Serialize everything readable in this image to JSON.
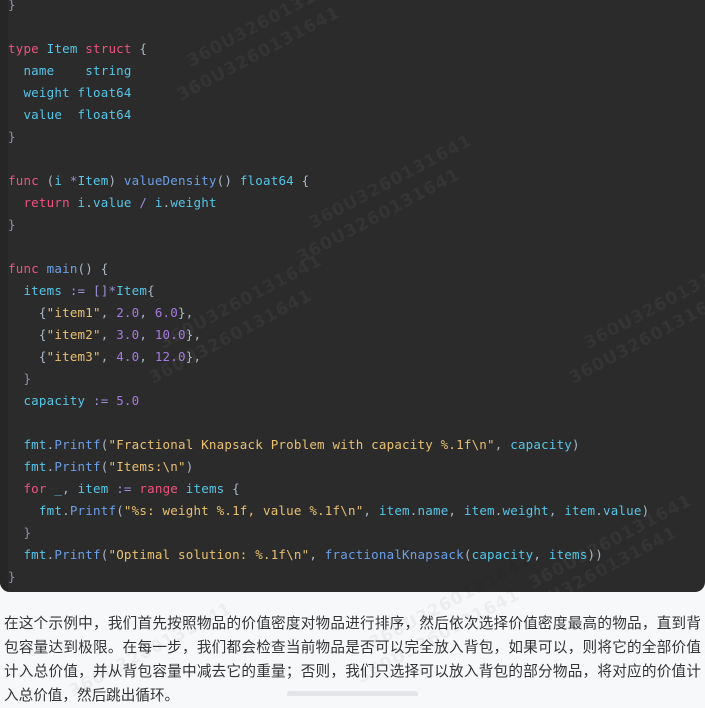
{
  "watermark": {
    "text": "360U3260131641",
    "repeats": 8
  },
  "code_block": {
    "language": "go",
    "background": "#2b2b2b",
    "colors": {
      "keyword": "#f0527f",
      "identifier": "#54c6e8",
      "function": "#6b9fe8",
      "string": "#e8c070",
      "number": "#a679e0",
      "operator": "#9a8fd8",
      "punctuation": "#a9b7c6"
    },
    "lines": [
      {
        "indent": 0,
        "tokens": [
          {
            "t": "}",
            "c": "brc"
          }
        ]
      },
      {
        "indent": 0,
        "tokens": []
      },
      {
        "indent": 0,
        "tokens": [
          {
            "t": "type",
            "c": "kw"
          },
          {
            "t": " ",
            "c": "pun"
          },
          {
            "t": "Item",
            "c": "id"
          },
          {
            "t": " ",
            "c": "pun"
          },
          {
            "t": "struct",
            "c": "kw"
          },
          {
            "t": " ",
            "c": "pun"
          },
          {
            "t": "{",
            "c": "pun"
          }
        ]
      },
      {
        "indent": 1,
        "tokens": [
          {
            "t": "name",
            "c": "id"
          },
          {
            "t": "    ",
            "c": "pun"
          },
          {
            "t": "string",
            "c": "id"
          }
        ]
      },
      {
        "indent": 1,
        "tokens": [
          {
            "t": "weight",
            "c": "id"
          },
          {
            "t": " ",
            "c": "pun"
          },
          {
            "t": "float64",
            "c": "id"
          }
        ]
      },
      {
        "indent": 1,
        "tokens": [
          {
            "t": "value",
            "c": "id"
          },
          {
            "t": "  ",
            "c": "pun"
          },
          {
            "t": "float64",
            "c": "id"
          }
        ]
      },
      {
        "indent": 0,
        "tokens": [
          {
            "t": "}",
            "c": "brc"
          }
        ]
      },
      {
        "indent": 0,
        "tokens": []
      },
      {
        "indent": 0,
        "tokens": [
          {
            "t": "func",
            "c": "kw"
          },
          {
            "t": " (",
            "c": "pun"
          },
          {
            "t": "i",
            "c": "id"
          },
          {
            "t": " ",
            "c": "pun"
          },
          {
            "t": "*",
            "c": "op"
          },
          {
            "t": "Item",
            "c": "id"
          },
          {
            "t": ") ",
            "c": "pun"
          },
          {
            "t": "valueDensity",
            "c": "fn"
          },
          {
            "t": "() ",
            "c": "pun"
          },
          {
            "t": "float64",
            "c": "id"
          },
          {
            "t": " {",
            "c": "pun"
          }
        ]
      },
      {
        "indent": 1,
        "tokens": [
          {
            "t": "return",
            "c": "kw"
          },
          {
            "t": " ",
            "c": "pun"
          },
          {
            "t": "i",
            "c": "id"
          },
          {
            "t": ".",
            "c": "pun"
          },
          {
            "t": "value",
            "c": "id"
          },
          {
            "t": " ",
            "c": "pun"
          },
          {
            "t": "/",
            "c": "op"
          },
          {
            "t": " ",
            "c": "pun"
          },
          {
            "t": "i",
            "c": "id"
          },
          {
            "t": ".",
            "c": "pun"
          },
          {
            "t": "weight",
            "c": "id"
          }
        ]
      },
      {
        "indent": 0,
        "tokens": [
          {
            "t": "}",
            "c": "brc"
          }
        ]
      },
      {
        "indent": 0,
        "tokens": []
      },
      {
        "indent": 0,
        "tokens": [
          {
            "t": "func",
            "c": "kw"
          },
          {
            "t": " ",
            "c": "pun"
          },
          {
            "t": "main",
            "c": "fn"
          },
          {
            "t": "() {",
            "c": "pun"
          }
        ]
      },
      {
        "indent": 1,
        "tokens": [
          {
            "t": "items",
            "c": "id"
          },
          {
            "t": " ",
            "c": "pun"
          },
          {
            "t": ":=",
            "c": "op"
          },
          {
            "t": " ",
            "c": "pun"
          },
          {
            "t": "[]",
            "c": "op"
          },
          {
            "t": "*",
            "c": "op"
          },
          {
            "t": "Item",
            "c": "id"
          },
          {
            "t": "{",
            "c": "pun"
          }
        ]
      },
      {
        "indent": 2,
        "tokens": [
          {
            "t": "{",
            "c": "pun"
          },
          {
            "t": "\"item1\"",
            "c": "str"
          },
          {
            "t": ", ",
            "c": "pun"
          },
          {
            "t": "2.0",
            "c": "num"
          },
          {
            "t": ", ",
            "c": "pun"
          },
          {
            "t": "6.0",
            "c": "num"
          },
          {
            "t": "},",
            "c": "pun"
          }
        ]
      },
      {
        "indent": 2,
        "tokens": [
          {
            "t": "{",
            "c": "pun"
          },
          {
            "t": "\"item2\"",
            "c": "str"
          },
          {
            "t": ", ",
            "c": "pun"
          },
          {
            "t": "3.0",
            "c": "num"
          },
          {
            "t": ", ",
            "c": "pun"
          },
          {
            "t": "10.0",
            "c": "num"
          },
          {
            "t": "},",
            "c": "pun"
          }
        ]
      },
      {
        "indent": 2,
        "tokens": [
          {
            "t": "{",
            "c": "pun"
          },
          {
            "t": "\"item3\"",
            "c": "str"
          },
          {
            "t": ", ",
            "c": "pun"
          },
          {
            "t": "4.0",
            "c": "num"
          },
          {
            "t": ", ",
            "c": "pun"
          },
          {
            "t": "12.0",
            "c": "num"
          },
          {
            "t": "},",
            "c": "pun"
          }
        ]
      },
      {
        "indent": 1,
        "tokens": [
          {
            "t": "}",
            "c": "brc"
          }
        ]
      },
      {
        "indent": 1,
        "tokens": [
          {
            "t": "capacity",
            "c": "id"
          },
          {
            "t": " ",
            "c": "pun"
          },
          {
            "t": ":=",
            "c": "op"
          },
          {
            "t": " ",
            "c": "pun"
          },
          {
            "t": "5.0",
            "c": "num"
          }
        ]
      },
      {
        "indent": 0,
        "tokens": []
      },
      {
        "indent": 1,
        "tokens": [
          {
            "t": "fmt",
            "c": "id"
          },
          {
            "t": ".",
            "c": "pun"
          },
          {
            "t": "Printf",
            "c": "fn"
          },
          {
            "t": "(",
            "c": "pun"
          },
          {
            "t": "\"Fractional Knapsack Problem with capacity %.1f\\n\"",
            "c": "str"
          },
          {
            "t": ", ",
            "c": "pun"
          },
          {
            "t": "capacity",
            "c": "id"
          },
          {
            "t": ")",
            "c": "pun"
          }
        ]
      },
      {
        "indent": 1,
        "tokens": [
          {
            "t": "fmt",
            "c": "id"
          },
          {
            "t": ".",
            "c": "pun"
          },
          {
            "t": "Printf",
            "c": "fn"
          },
          {
            "t": "(",
            "c": "pun"
          },
          {
            "t": "\"Items:\\n\"",
            "c": "str"
          },
          {
            "t": ")",
            "c": "pun"
          }
        ]
      },
      {
        "indent": 1,
        "tokens": [
          {
            "t": "for",
            "c": "kw"
          },
          {
            "t": " ",
            "c": "pun"
          },
          {
            "t": "_",
            "c": "id"
          },
          {
            "t": ", ",
            "c": "pun"
          },
          {
            "t": "item",
            "c": "id"
          },
          {
            "t": " ",
            "c": "pun"
          },
          {
            "t": ":=",
            "c": "op"
          },
          {
            "t": " ",
            "c": "pun"
          },
          {
            "t": "range",
            "c": "kw"
          },
          {
            "t": " ",
            "c": "pun"
          },
          {
            "t": "items",
            "c": "id"
          },
          {
            "t": " {",
            "c": "pun"
          }
        ]
      },
      {
        "indent": 2,
        "tokens": [
          {
            "t": "fmt",
            "c": "id"
          },
          {
            "t": ".",
            "c": "pun"
          },
          {
            "t": "Printf",
            "c": "fn"
          },
          {
            "t": "(",
            "c": "pun"
          },
          {
            "t": "\"%s: weight %.1f, value %.1f\\n\"",
            "c": "str"
          },
          {
            "t": ", ",
            "c": "pun"
          },
          {
            "t": "item",
            "c": "id"
          },
          {
            "t": ".",
            "c": "pun"
          },
          {
            "t": "name",
            "c": "id"
          },
          {
            "t": ", ",
            "c": "pun"
          },
          {
            "t": "item",
            "c": "id"
          },
          {
            "t": ".",
            "c": "pun"
          },
          {
            "t": "weight",
            "c": "id"
          },
          {
            "t": ", ",
            "c": "pun"
          },
          {
            "t": "item",
            "c": "id"
          },
          {
            "t": ".",
            "c": "pun"
          },
          {
            "t": "value",
            "c": "id"
          },
          {
            "t": ")",
            "c": "pun"
          }
        ]
      },
      {
        "indent": 1,
        "tokens": [
          {
            "t": "}",
            "c": "brc"
          }
        ]
      },
      {
        "indent": 1,
        "tokens": [
          {
            "t": "fmt",
            "c": "id"
          },
          {
            "t": ".",
            "c": "pun"
          },
          {
            "t": "Printf",
            "c": "fn"
          },
          {
            "t": "(",
            "c": "pun"
          },
          {
            "t": "\"Optimal solution: %.1f\\n\"",
            "c": "str"
          },
          {
            "t": ", ",
            "c": "pun"
          },
          {
            "t": "fractionalKnapsack",
            "c": "fn"
          },
          {
            "t": "(",
            "c": "pun"
          },
          {
            "t": "capacity",
            "c": "id"
          },
          {
            "t": ", ",
            "c": "pun"
          },
          {
            "t": "items",
            "c": "id"
          },
          {
            "t": "))",
            "c": "pun"
          }
        ]
      },
      {
        "indent": 0,
        "tokens": [
          {
            "t": "}",
            "c": "brc"
          }
        ]
      }
    ]
  },
  "prose": {
    "paragraph": "在这个示例中，我们首先按照物品的价值密度对物品进行排序，然后依次选择价值密度最高的物品，直到背包容量达到极限。在每一步，我们都会检查当前物品是否可以完全放入背包，如果可以，则将它的全部价值计入总价值，并从背包容量中减去它的重量；否则，我们只选择可以放入背包的部分物品，将对应的价值计入总价值，然后跳出循环。"
  }
}
